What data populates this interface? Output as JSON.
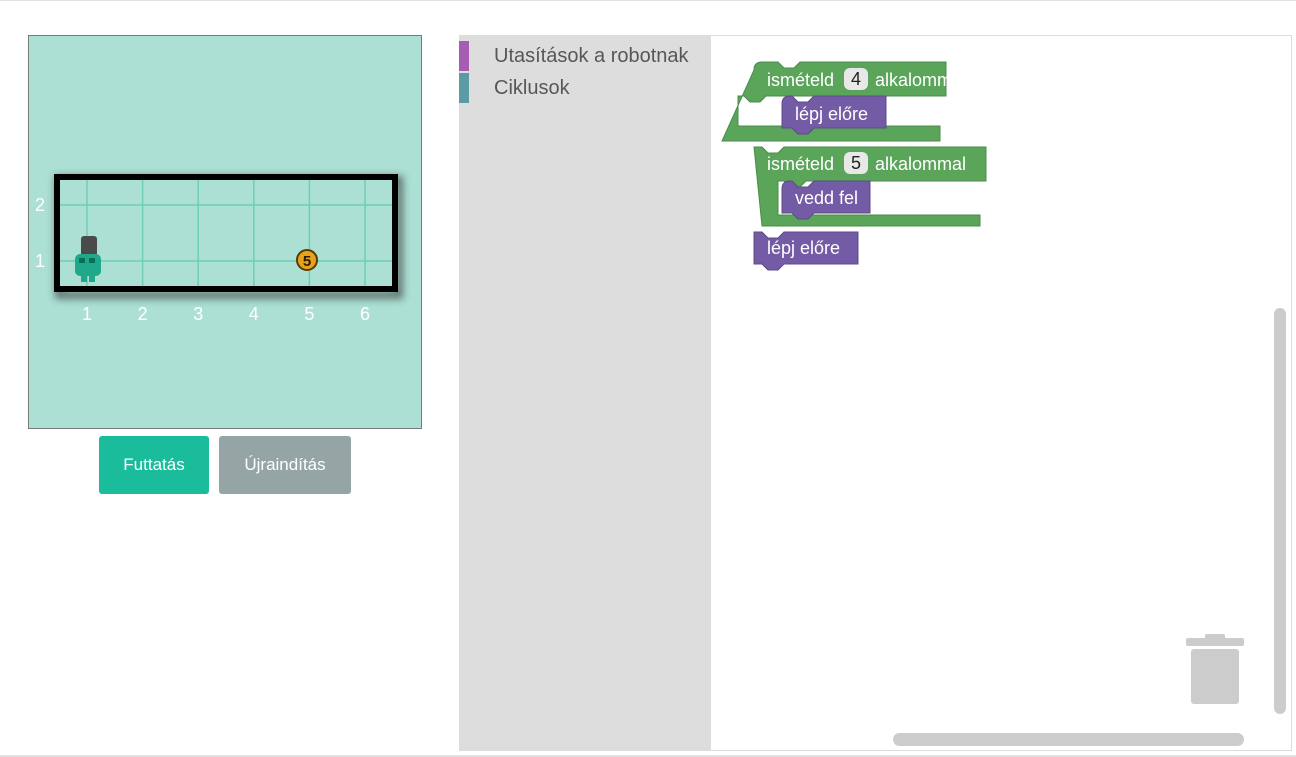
{
  "stage": {
    "grid_cols": 6,
    "grid_rows": 2,
    "x_labels": [
      "1",
      "2",
      "3",
      "4",
      "5",
      "6"
    ],
    "y_labels": [
      "2",
      "1"
    ],
    "robot": {
      "col": 1,
      "row": 1,
      "label": "robot"
    },
    "coin": {
      "col": 5,
      "row": 1,
      "value": "5"
    },
    "colors": {
      "background": "#ace0d4",
      "grid_line": "#6fcfb0",
      "frame": "#000000"
    }
  },
  "buttons": {
    "run": "Futtatás",
    "reset": "Újraindítás"
  },
  "toolbox": {
    "categories": [
      {
        "label": "Utasítások a robotnak",
        "color": "#a55db4"
      },
      {
        "label": "Ciklusok",
        "color": "#5b9ba5"
      }
    ]
  },
  "workspace": {
    "blocks": [
      {
        "type": "repeat",
        "prefix": "ismételd",
        "count": "4",
        "suffix": "alkalommal",
        "body": "lépj előre"
      },
      {
        "type": "repeat",
        "prefix": "ismételd",
        "count": "5",
        "suffix": "alkalommal",
        "body": "vedd fel"
      },
      {
        "type": "statement",
        "text": "lépj előre"
      }
    ],
    "colors": {
      "loop": "#5ba55b",
      "action": "#745ba5"
    },
    "trash_icon": "trash-can-icon"
  }
}
